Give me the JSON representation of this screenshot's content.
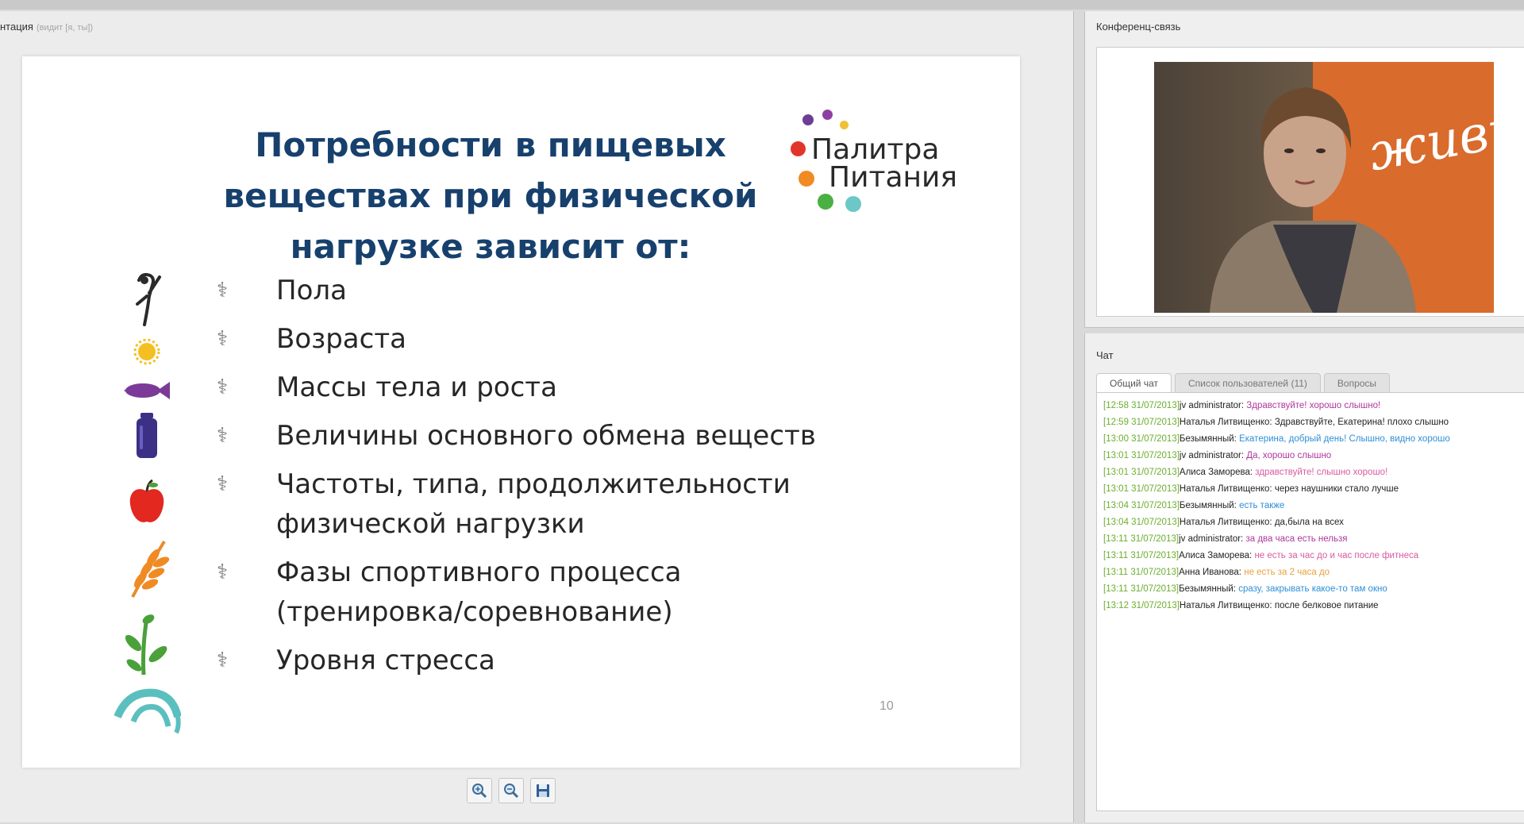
{
  "presentation": {
    "header_title": "нтация",
    "header_sub": "(видит [я, ты])",
    "slide": {
      "title_lines": [
        "Потребности в пищевых",
        "веществах при физической",
        "нагрузке зависит от:"
      ],
      "logo": {
        "line1": "Палитра",
        "line2": "Питания"
      },
      "bullets": [
        {
          "lines": [
            "Пола"
          ]
        },
        {
          "lines": [
            "Возраста"
          ]
        },
        {
          "lines": [
            "Массы тела и роста"
          ]
        },
        {
          "lines": [
            "Величины основного обмена веществ"
          ]
        },
        {
          "lines": [
            "Частоты, типа, продолжительности",
            "физической нагрузки"
          ]
        },
        {
          "lines": [
            "Фазы спортивного процесса",
            "(тренировка/соревнование)"
          ]
        },
        {
          "lines": [
            "Уровня стресса"
          ]
        }
      ],
      "page_number": "10",
      "icons": [
        "dancer-icon",
        "sun-icon",
        "fish-icon",
        "bottle-icon",
        "apple-icon",
        "wheat-icon",
        "sprout-icon",
        "wave-icon"
      ]
    },
    "toolbar": [
      "zoom-in-icon",
      "zoom-out-icon",
      "save-icon"
    ]
  },
  "conference": {
    "title": "Конференц-связь",
    "video_text": "живи!"
  },
  "chat": {
    "title": "Чат",
    "tabs": [
      {
        "label": "Общий чат",
        "active": true
      },
      {
        "label": "Список пользователей (11)",
        "active": false
      },
      {
        "label": "Вопросы",
        "active": false
      }
    ],
    "messages": [
      {
        "time": "[12:58 31/07/2013]",
        "author": "jv administrator:",
        "text": "Здравствуйте! хорошо слышно!",
        "color": "#b0369e"
      },
      {
        "time": "[12:59 31/07/2013]",
        "author": "Наталья Литвищенко:",
        "text": "Здравствуйте, Екатерина! плохо слышно",
        "color": "#222222"
      },
      {
        "time": "[13:00 31/07/2013]",
        "author": "Безымянный:",
        "text": "Екатерина, добрый день! Слышно, видно хорошо",
        "color": "#2e8fd8"
      },
      {
        "time": "[13:01 31/07/2013]",
        "author": "jv administrator:",
        "text": "Да, хорошо слышно",
        "color": "#b0369e"
      },
      {
        "time": "[13:01 31/07/2013]",
        "author": "Алиса Заморева:",
        "text": "здравствуйте! слышно хорошо!",
        "color": "#d85aa0"
      },
      {
        "time": "[13:01 31/07/2013]",
        "author": "Наталья Литвищенко:",
        "text": "через наушники стало лучше",
        "color": "#222222"
      },
      {
        "time": "[13:04 31/07/2013]",
        "author": "Безымянный:",
        "text": "есть также",
        "color": "#2e8fd8"
      },
      {
        "time": "[13:04 31/07/2013]",
        "author": "Наталья Литвищенко:",
        "text": "да,была на всех",
        "color": "#222222"
      },
      {
        "time": "[13:11 31/07/2013]",
        "author": "jv administrator:",
        "text": "за два часа есть нельзя",
        "color": "#b0369e"
      },
      {
        "time": "[13:11 31/07/2013]",
        "author": "Алиса Заморева:",
        "text": "не есть за час до и час после фитнеса",
        "color": "#d85aa0"
      },
      {
        "time": "[13:11 31/07/2013]",
        "author": "Анна Иванова:",
        "text": "не есть за 2 часа до",
        "color": "#e8a23a"
      },
      {
        "time": "[13:11 31/07/2013]",
        "author": "Безымянный:",
        "text": "сразу, закрывать какое-то там окно",
        "color": "#2e8fd8"
      },
      {
        "time": "[13:12 31/07/2013]",
        "author": "Наталья Литвищенко:",
        "text": "после белковое питание",
        "color": "#222222"
      }
    ]
  }
}
